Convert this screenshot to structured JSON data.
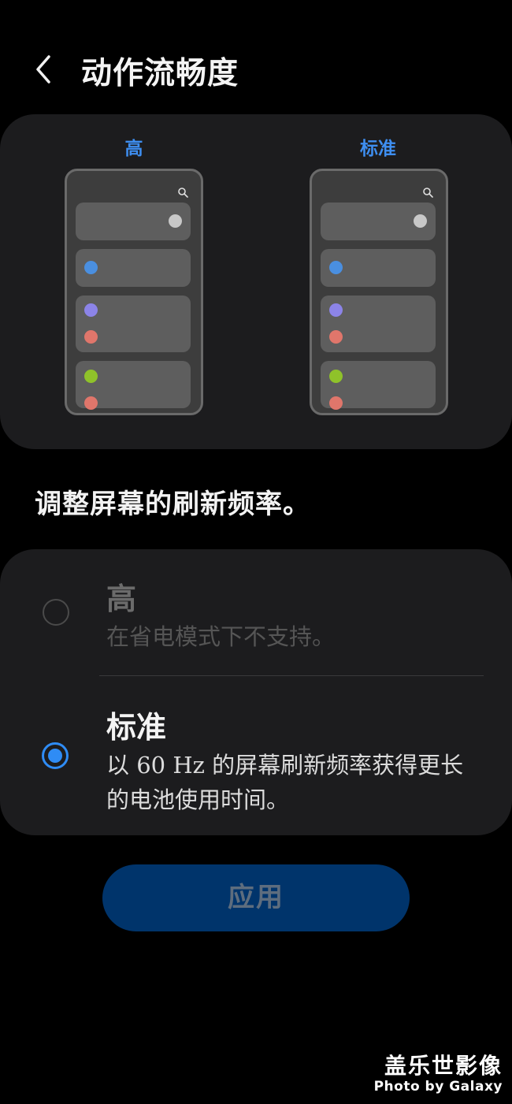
{
  "header": {
    "title": "动作流畅度",
    "back_icon": "chevron-left-icon"
  },
  "preview": {
    "high_label": "高",
    "standard_label": "标准",
    "colors": {
      "label": "#3e8ef0",
      "toggle_dot": "#c8c8c8",
      "blue_dot": "#4a8fe0",
      "purple_dot": "#8c84e8",
      "red_dot": "#e0766b",
      "green_dot": "#8fc22a"
    }
  },
  "description": "调整屏幕的刷新频率。",
  "options": [
    {
      "title": "高",
      "subtitle": "在省电模式下不支持。",
      "selected": false,
      "enabled": false
    },
    {
      "title": "标准",
      "subtitle": "以 60 Hz 的屏幕刷新频率获得更长的电池使用时间。",
      "selected": true,
      "enabled": true
    }
  ],
  "apply_button": {
    "label": "应用",
    "enabled": false
  },
  "watermark": {
    "title": "盖乐世影像",
    "subtitle": "Photo by Galaxy"
  },
  "theme": {
    "accent": "#2f8cf5",
    "panel_bg": "#1c1c1e",
    "button_bg": "#00346b"
  }
}
